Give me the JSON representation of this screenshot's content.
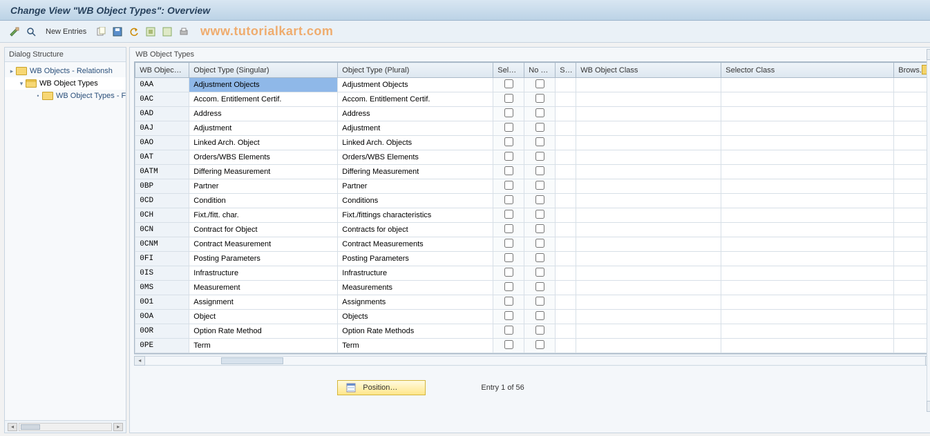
{
  "title": "Change View \"WB Object Types\": Overview",
  "watermark": "www.tutorialkart.com",
  "toolbar": {
    "new_entries": "New Entries"
  },
  "sidebar": {
    "title": "Dialog Structure",
    "items": [
      {
        "label": "WB Objects - Relationsh",
        "level": 1,
        "open": false,
        "twisty": "▸"
      },
      {
        "label": "WB Object Types",
        "level": 2,
        "open": true,
        "twisty": "▾",
        "selected": true
      },
      {
        "label": "WB Object Types - F",
        "level": 3,
        "open": false,
        "twisty": "•"
      }
    ]
  },
  "table": {
    "title": "WB Object Types",
    "columns": [
      "WB Objec…",
      "Object Type (Singular)",
      "Object Type (Plural)",
      "Selec…",
      "No E…",
      "S…",
      "WB Object Class",
      "Selector Class",
      "Brows.Ob"
    ],
    "rows": [
      {
        "code": "0AA",
        "sing": "Adjustment Objects",
        "plur": "Adjustment Objects",
        "sel": false,
        "noe": false,
        "s": "",
        "cls": "",
        "selc": "",
        "b": "",
        "hl": true
      },
      {
        "code": "0AC",
        "sing": "Accom. Entitlement Certif.",
        "plur": "Accom. Entitlement Certif.",
        "sel": false,
        "noe": false,
        "s": "",
        "cls": "",
        "selc": "",
        "b": ""
      },
      {
        "code": "0AD",
        "sing": "Address",
        "plur": "Address",
        "sel": false,
        "noe": false,
        "s": "",
        "cls": "",
        "selc": "",
        "b": ""
      },
      {
        "code": "0AJ",
        "sing": "Adjustment",
        "plur": "Adjustment",
        "sel": false,
        "noe": false,
        "s": "",
        "cls": "",
        "selc": "",
        "b": ""
      },
      {
        "code": "0AO",
        "sing": "Linked Arch. Object",
        "plur": "Linked Arch. Objects",
        "sel": false,
        "noe": false,
        "s": "",
        "cls": "",
        "selc": "",
        "b": ""
      },
      {
        "code": "0AT",
        "sing": "Orders/WBS Elements",
        "plur": "Orders/WBS Elements",
        "sel": false,
        "noe": false,
        "s": "",
        "cls": "",
        "selc": "",
        "b": ""
      },
      {
        "code": "0ATM",
        "sing": "Differing Measurement",
        "plur": "Differing Measurement",
        "sel": false,
        "noe": false,
        "s": "",
        "cls": "",
        "selc": "",
        "b": ""
      },
      {
        "code": "0BP",
        "sing": "Partner",
        "plur": "Partner",
        "sel": false,
        "noe": false,
        "s": "",
        "cls": "",
        "selc": "",
        "b": ""
      },
      {
        "code": "0CD",
        "sing": "Condition",
        "plur": "Conditions",
        "sel": false,
        "noe": false,
        "s": "",
        "cls": "",
        "selc": "",
        "b": ""
      },
      {
        "code": "0CH",
        "sing": "Fixt./fitt. char.",
        "plur": "Fixt./fittings characteristics",
        "sel": false,
        "noe": false,
        "s": "",
        "cls": "",
        "selc": "",
        "b": ""
      },
      {
        "code": "0CN",
        "sing": "Contract for Object",
        "plur": "Contracts for object",
        "sel": false,
        "noe": false,
        "s": "",
        "cls": "",
        "selc": "",
        "b": ""
      },
      {
        "code": "0CNM",
        "sing": "Contract Measurement",
        "plur": "Contract Measurements",
        "sel": false,
        "noe": false,
        "s": "",
        "cls": "",
        "selc": "",
        "b": ""
      },
      {
        "code": "0FI",
        "sing": "Posting Parameters",
        "plur": "Posting Parameters",
        "sel": false,
        "noe": false,
        "s": "",
        "cls": "",
        "selc": "",
        "b": ""
      },
      {
        "code": "0IS",
        "sing": "Infrastructure",
        "plur": "Infrastructure",
        "sel": false,
        "noe": false,
        "s": "",
        "cls": "",
        "selc": "",
        "b": ""
      },
      {
        "code": "0MS",
        "sing": "Measurement",
        "plur": "Measurements",
        "sel": false,
        "noe": false,
        "s": "",
        "cls": "",
        "selc": "",
        "b": ""
      },
      {
        "code": "0O1",
        "sing": "Assignment",
        "plur": "Assignments",
        "sel": false,
        "noe": false,
        "s": "",
        "cls": "",
        "selc": "",
        "b": ""
      },
      {
        "code": "0OA",
        "sing": "Object",
        "plur": "Objects",
        "sel": false,
        "noe": false,
        "s": "",
        "cls": "",
        "selc": "",
        "b": ""
      },
      {
        "code": "0OR",
        "sing": "Option Rate Method",
        "plur": "Option Rate Methods",
        "sel": false,
        "noe": false,
        "s": "",
        "cls": "",
        "selc": "",
        "b": ""
      },
      {
        "code": "0PE",
        "sing": "Term",
        "plur": "Term",
        "sel": false,
        "noe": false,
        "s": "",
        "cls": "",
        "selc": "",
        "b": ""
      }
    ]
  },
  "footer": {
    "position_label": "Position…",
    "entry_info": "Entry 1 of 56"
  }
}
